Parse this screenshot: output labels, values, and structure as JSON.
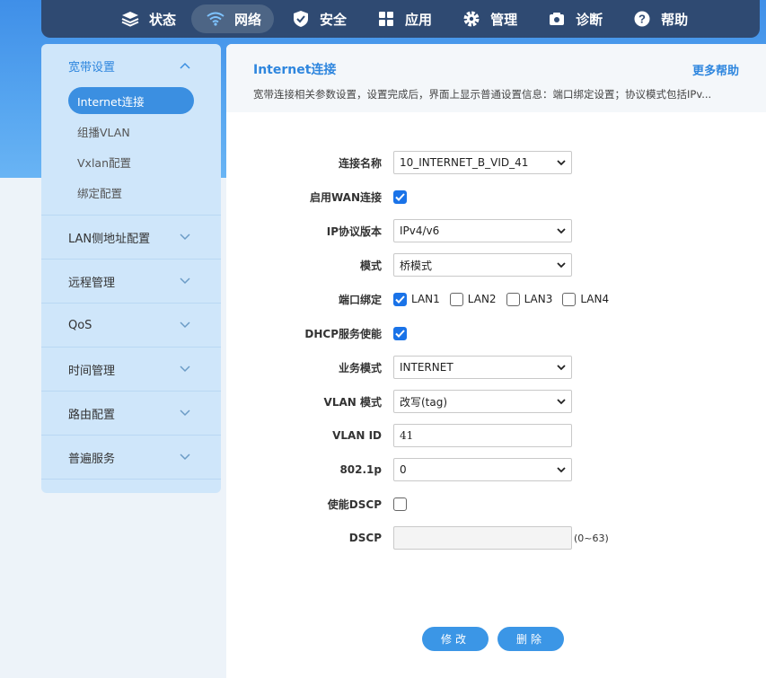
{
  "nav": {
    "items": [
      {
        "label": "状态",
        "icon": "layers-icon"
      },
      {
        "label": "网络",
        "icon": "wifi-icon",
        "active": true
      },
      {
        "label": "安全",
        "icon": "shield-icon"
      },
      {
        "label": "应用",
        "icon": "grid-icon"
      },
      {
        "label": "管理",
        "icon": "gear-icon"
      },
      {
        "label": "诊断",
        "icon": "camera-icon"
      },
      {
        "label": "帮助",
        "icon": "help-icon"
      }
    ]
  },
  "sidebar": {
    "open_group": "宽带设置",
    "sub_items": [
      "Internet连接",
      "组播VLAN",
      "Vxlan配置",
      "绑定配置"
    ],
    "groups": [
      "LAN侧地址配置",
      "远程管理",
      "QoS",
      "时间管理",
      "路由配置",
      "普遍服务"
    ]
  },
  "main": {
    "title": "Internet连接",
    "help": "更多帮助",
    "desc": "宽带连接相关参数设置，设置完成后，界面上显示普通设置信息：端口绑定设置；协议模式包括IPv..."
  },
  "form": {
    "conn_name_label": "连接名称",
    "conn_name_value": "10_INTERNET_B_VID_41",
    "wan_enable_label": "启用WAN连接",
    "ip_proto_label": "IP协议版本",
    "ip_proto_value": "IPv4/v6",
    "mode_label": "模式",
    "mode_value": "桥模式",
    "port_bind_label": "端口绑定",
    "ports": [
      "LAN1",
      "LAN2",
      "LAN3",
      "LAN4"
    ],
    "dhcp_label": "DHCP服务使能",
    "service_mode_label": "业务模式",
    "service_mode_value": "INTERNET",
    "vlan_mode_label": "VLAN 模式",
    "vlan_mode_value": "改写(tag)",
    "vlan_id_label": "VLAN ID",
    "vlan_id_value": "41",
    "p8021_label": "802.1p",
    "p8021_value": "0",
    "dscp_enable_label": "使能DSCP",
    "dscp_label": "DSCP",
    "dscp_hint": "(0~63)"
  },
  "buttons": {
    "modify": "修改",
    "delete": "删除"
  },
  "colors": {
    "accent": "#2e86de",
    "nav_bg": "#2f4a72",
    "checkbox_on": "#1a73e8"
  }
}
